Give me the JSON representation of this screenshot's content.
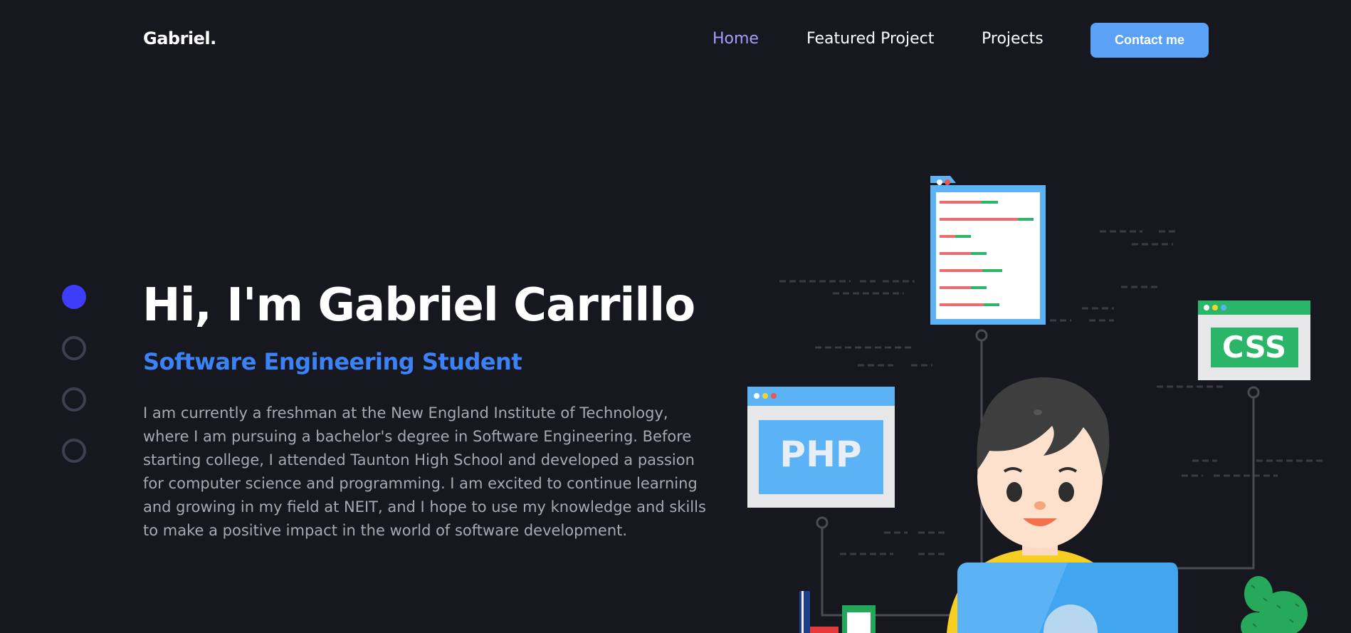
{
  "header": {
    "logo": "Gabriel.",
    "nav": [
      {
        "label": "Home",
        "active": true
      },
      {
        "label": "Featured Project",
        "active": false
      },
      {
        "label": "Projects",
        "active": false
      }
    ],
    "contact_label": "Contact me"
  },
  "hero": {
    "title": "Hi, I'm Gabriel Carrillo",
    "subtitle": "Software Engineering Student",
    "description": "I am currently a freshman at the New England Institute of Technology, where I am pursuing a bachelor's degree in Software Engineering. Before starting college, I attended Taunton High School and developed a passion for computer science and programming. I am excited to continue learning and growing in my field at NEIT, and I hope to use my knowledge and skills to make a positive impact in the world of software development."
  },
  "section_dots": {
    "count": 4,
    "active_index": 0
  },
  "illustration": {
    "php_label": "PHP",
    "css_label": "CSS"
  },
  "colors": {
    "background": "#17181f",
    "accent": "#3b82f6",
    "nav_active": "#a99bff",
    "button": "#5aa2f5",
    "dot_active": "#3d3dfb"
  }
}
